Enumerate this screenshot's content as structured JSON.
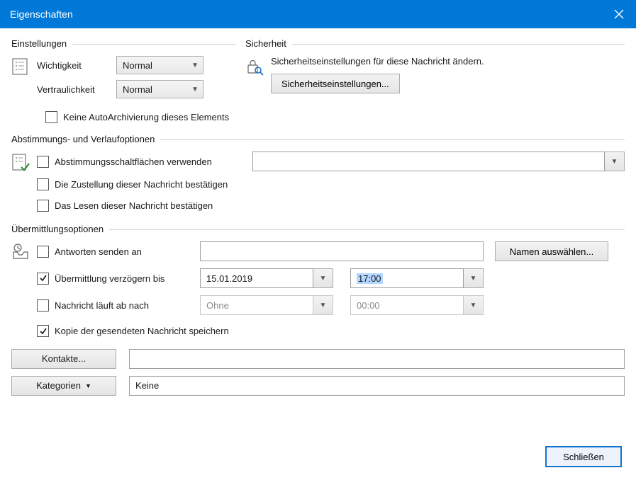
{
  "window": {
    "title": "Eigenschaften"
  },
  "settings": {
    "legend": "Einstellungen",
    "importance_label": "Wichtigkeit",
    "importance_value": "Normal",
    "sensitivity_label": "Vertraulichkeit",
    "sensitivity_value": "Normal",
    "no_autoarchive_label": "Keine AutoArchivierung dieses Elements"
  },
  "security": {
    "legend": "Sicherheit",
    "desc": "Sicherheitseinstellungen für diese Nachricht ändern.",
    "button": "Sicherheitseinstellungen..."
  },
  "voting": {
    "legend": "Abstimmungs- und Verlaufoptionen",
    "use_buttons_label": "Abstimmungsschaltflächen verwenden",
    "delivery_receipt_label": "Die Zustellung dieser Nachricht bestätigen",
    "read_receipt_label": "Das Lesen dieser Nachricht bestätigen"
  },
  "delivery": {
    "legend": "Übermittlungsoptionen",
    "reply_to_label": "Antworten senden an",
    "select_names_btn": "Namen auswählen...",
    "delay_label": "Übermittlung verzögern bis",
    "delay_date": "15.01.2019",
    "delay_time": "17:00",
    "expire_label": "Nachricht läuft ab nach",
    "expire_date": "Ohne",
    "expire_time": "00:00",
    "save_copy_label": "Kopie der gesendeten Nachricht speichern"
  },
  "contacts_btn": "Kontakte...",
  "categories_btn": "Kategorien",
  "categories_value": "Keine",
  "close_btn": "Schließen"
}
